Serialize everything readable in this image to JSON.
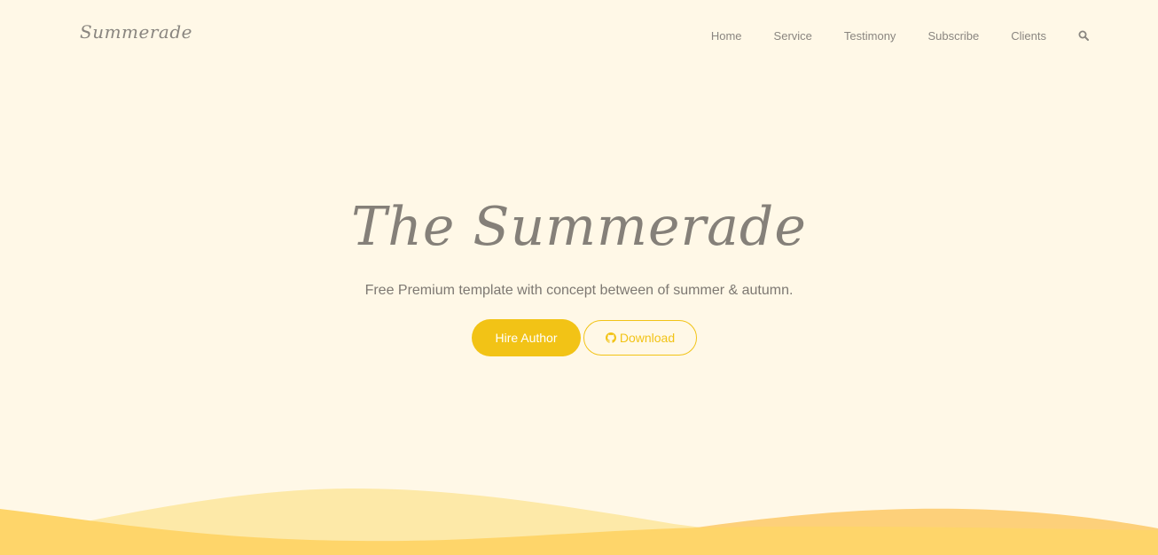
{
  "brand": {
    "name": "Summerade"
  },
  "nav": {
    "items": [
      {
        "label": "Home"
      },
      {
        "label": "Service"
      },
      {
        "label": "Testimony"
      },
      {
        "label": "Subscribe"
      },
      {
        "label": "Clients"
      }
    ],
    "search_icon": "search-icon"
  },
  "hero": {
    "title": "The Summerade",
    "subtitle": "Free Premium template with concept between of summer & autumn.",
    "hire_label": "Hire Author",
    "download_label": "Download",
    "download_icon": "github-icon"
  },
  "colors": {
    "background": "#fff8e7",
    "accent": "#f2c316",
    "text": "#858079",
    "wave_light": "#fde9a8",
    "wave_mid": "#fed56a",
    "wave_orange": "#fdd07a"
  }
}
